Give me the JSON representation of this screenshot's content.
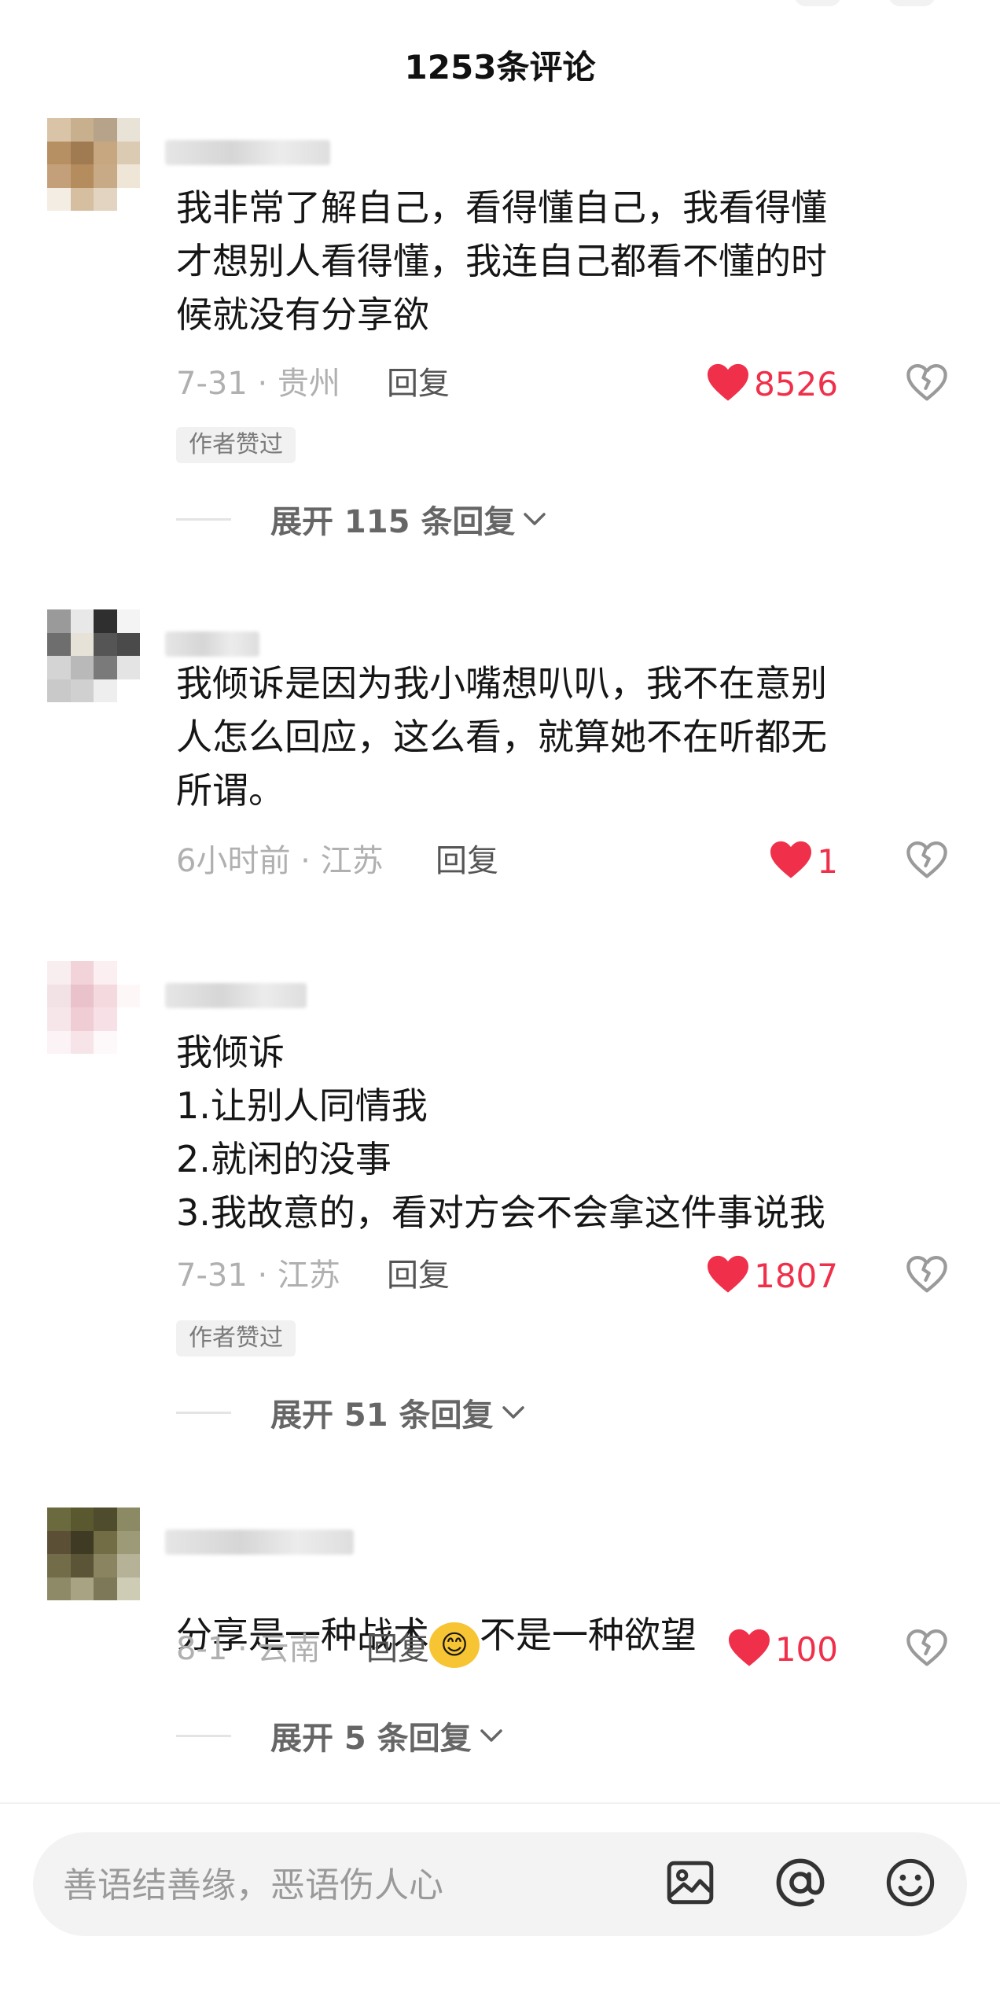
{
  "header": {
    "title": "1253条评论"
  },
  "colors": {
    "like": "#f0304a",
    "meta": "#b0b0b0",
    "badge_bg": "#f1f1f1"
  },
  "comments": [
    {
      "text": "我非常了解自己，看得懂自己，我看得懂\n才想别人看得懂，我连自己都看不懂的时\n候就没有分享欲",
      "date": "7-31 · 贵州",
      "reply_label": "回复",
      "likes": "8526",
      "badge": "作者赞过",
      "expand": "展开 115 条回复"
    },
    {
      "text": "我倾诉是因为我小嘴想叭叭，我不在意别\n人怎么回应，这么看，就算她不在听都无\n所谓。",
      "date": "6小时前 · 江苏",
      "reply_label": "回复",
      "likes": "1"
    },
    {
      "text": "我倾诉\n1.让别人同情我\n2.就闲的没事\n3.我故意的，看对方会不会拿这件事说我",
      "date": "7-31 · 江苏",
      "reply_label": "回复",
      "likes": "1807",
      "badge": "作者赞过",
      "expand": "展开 51 条回复"
    },
    {
      "text_before": "分享是一种战术",
      "emoji": "😊",
      "text_after": "不是一种欲望",
      "date": "8-1 · 云南",
      "reply_label": "回复",
      "likes": "100",
      "expand": "展开 5 条回复"
    }
  ],
  "input": {
    "placeholder": "善语结善缘，恶语伤人心"
  },
  "icons": [
    "heart-icon",
    "broken-heart-icon",
    "chevron-down-icon",
    "image-icon",
    "at-icon",
    "emoji-icon"
  ]
}
